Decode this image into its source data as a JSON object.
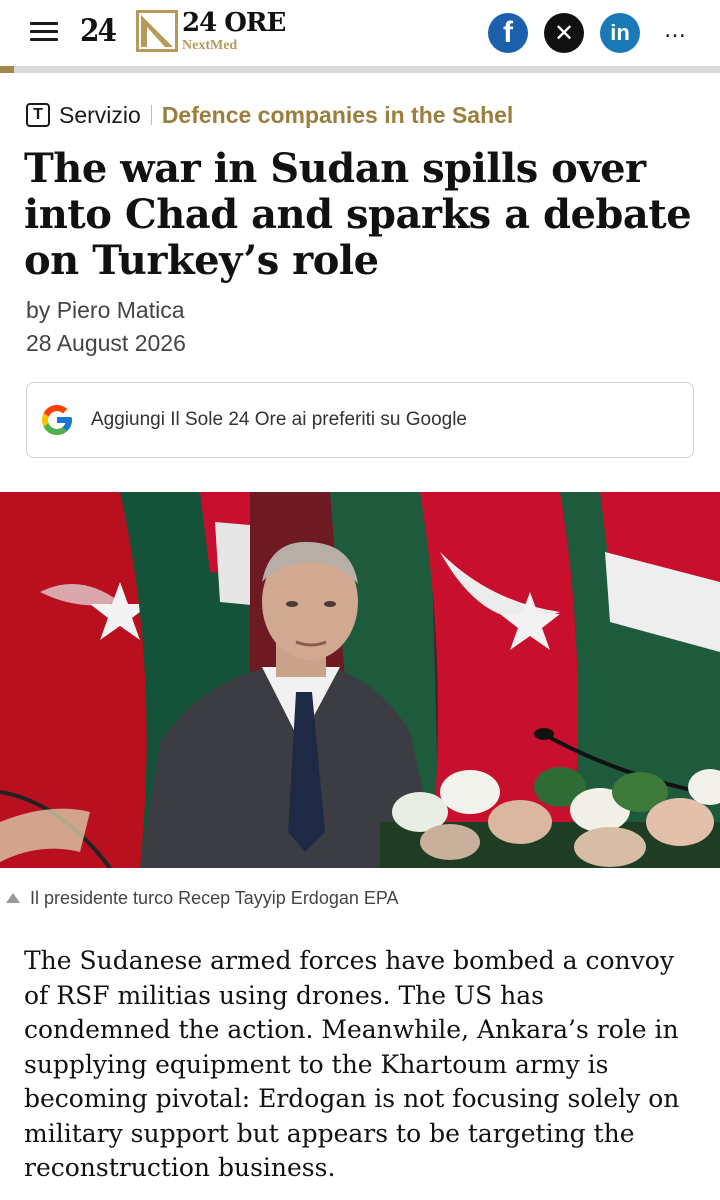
{
  "header": {
    "logo_24": "24",
    "logo_ore": "24 ORE",
    "logo_sub": "NextMed",
    "menu_icon": "hamburger-menu-icon",
    "share": {
      "facebook_icon": "f",
      "x_icon": "✕",
      "linkedin_icon": "in",
      "more_icon": "…"
    },
    "accent_color": "#a3864a"
  },
  "article": {
    "kicker_icon": "T",
    "kicker_label": "Servizio",
    "kicker_topic": "Defence companies in the Sahel",
    "headline": "The war in Sudan spills over into Chad and sparks a debate on Turkey’s role",
    "byline_prefix": "by",
    "author": "Piero Matica",
    "date": "28 August 2026",
    "google_button": "Aggiungi Il Sole 24 Ore ai preferiti su Google",
    "image_caption": "Il presidente turco Recep Tayyip Erdogan EPA",
    "lead": "The Sudanese armed forces have bombed a convoy of RSF militias using drones. The US has condemned the action. Meanwhile, Ankara’s role in supplying equipment to the Khartoum army is becoming pivotal: Erdogan is not focusing solely on military support but appears to be targeting the reconstruction business."
  },
  "colors": {
    "kicker_topic": "#9a7f3c",
    "facebook": "#1b5fad",
    "x": "#111111",
    "linkedin": "#1a7ab8",
    "flag_red": "#c8102e",
    "flag_green": "#1f6b45"
  }
}
